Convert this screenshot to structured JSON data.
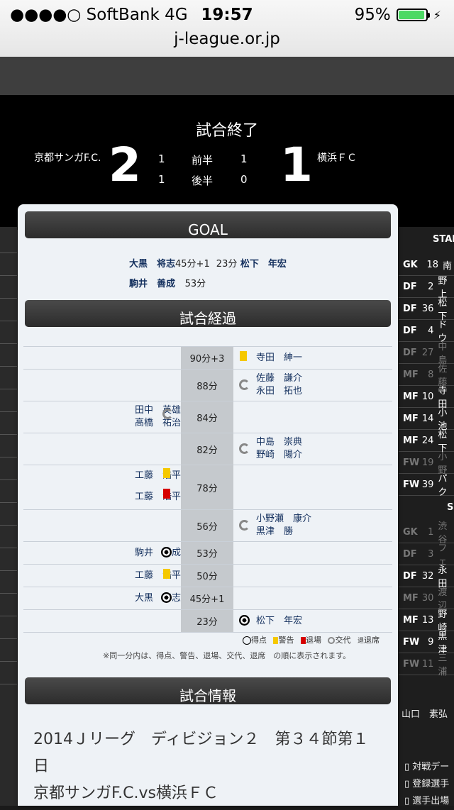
{
  "status_bar": {
    "signal": "●●●●○ SoftBank   4G",
    "time": "19:57",
    "battery": "95%"
  },
  "browser": {
    "url": "j-league.or.jp"
  },
  "score": {
    "status": "試合終了",
    "home_team": "京都サンガF.C.",
    "away_team": "横浜ＦＣ",
    "home_score": "2",
    "away_score": "1",
    "first_half": {
      "label": "前半",
      "home": "1",
      "away": "1"
    },
    "second_half": {
      "label": "後半",
      "home": "1",
      "away": "0"
    }
  },
  "goal_section": {
    "title": "GOAL",
    "goals": [
      {
        "home_player": "大黒　将志",
        "home_time": "45分+1",
        "away_time": "23分",
        "away_player": "松下　年宏"
      },
      {
        "home_player": "駒井　善成",
        "home_time": "53分"
      }
    ]
  },
  "timeline_section": {
    "title": "試合経過",
    "rows": [
      {
        "time": "90分+3",
        "right": [
          "寺田　紳一"
        ],
        "right_icon": "yellow-card-icon"
      },
      {
        "time": "88分",
        "right": [
          "佐藤　謙介",
          "永田　拓也"
        ],
        "right_icon": "substitution-icon"
      },
      {
        "time": "84分",
        "left": [
          "田中　英雄",
          "高橋　祐治"
        ],
        "left_icon": "substitution-icon"
      },
      {
        "time": "82分",
        "right": [
          "中島　崇典",
          "野崎　陽介"
        ],
        "right_icon": "substitution-icon"
      },
      {
        "time": "78分",
        "left": [
          "工藤　浩平",
          "工藤　浩平"
        ],
        "left_icon": "yellow-red-icons"
      },
      {
        "time": "56分",
        "right": [
          "小野瀬　康介",
          "黒津　勝"
        ],
        "right_icon": "substitution-icon"
      },
      {
        "time": "53分",
        "left": [
          "駒井　善成"
        ],
        "left_icon": "ball-icon"
      },
      {
        "time": "50分",
        "left": [
          "工藤　浩平"
        ],
        "left_icon": "yellow-card-icon"
      },
      {
        "time": "45分+1",
        "left": [
          "大黒　将志"
        ],
        "left_icon": "ball-icon"
      },
      {
        "time": "23分",
        "right": [
          "松下　年宏"
        ],
        "right_icon": "ball-icon"
      }
    ],
    "legend": [
      "得点",
      "警告",
      "退場",
      "交代",
      "退席"
    ],
    "legend_prefix": "退",
    "note": "※同一分内は、得点、警告、退場、交代、退席　の順に表示されます。"
  },
  "info_section": {
    "title": "試合情報",
    "competition": "2014Ｊリーグ　ディビジョン２　第３４節第１日",
    "match": "京都サンガF.C.vs横浜ＦＣ"
  },
  "lineup": {
    "header": "STAI",
    "starters": [
      {
        "pos": "GK",
        "num": "18",
        "name": "南",
        "dim": false
      },
      {
        "pos": "DF",
        "num": "2",
        "name": "野上",
        "dim": false
      },
      {
        "pos": "DF",
        "num": "36",
        "name": "松下",
        "dim": false
      },
      {
        "pos": "DF",
        "num": "4",
        "name": "ドウ",
        "dim": false
      },
      {
        "pos": "DF",
        "num": "27",
        "name": "中島",
        "dim": true
      },
      {
        "pos": "MF",
        "num": "8",
        "name": "佐藤",
        "dim": true
      },
      {
        "pos": "MF",
        "num": "10",
        "name": "寺田",
        "dim": false
      },
      {
        "pos": "MF",
        "num": "14",
        "name": "小池",
        "dim": false
      },
      {
        "pos": "MF",
        "num": "24",
        "name": "松下",
        "dim": false
      },
      {
        "pos": "FW",
        "num": "19",
        "name": "小野",
        "dim": true
      },
      {
        "pos": "FW",
        "num": "39",
        "name": "パク",
        "dim": false
      }
    ],
    "subs_header": "S",
    "subs": [
      {
        "pos": "GK",
        "num": "1",
        "name": "渋谷",
        "dim": true
      },
      {
        "pos": "DF",
        "num": "3",
        "name": "フェ",
        "dim": true
      },
      {
        "pos": "DF",
        "num": "32",
        "name": "永田",
        "dim": false
      },
      {
        "pos": "MF",
        "num": "30",
        "name": "渡辺",
        "dim": true
      },
      {
        "pos": "MF",
        "num": "13",
        "name": "野崎",
        "dim": false
      },
      {
        "pos": "FW",
        "num": "9",
        "name": "黒津",
        "dim": false
      },
      {
        "pos": "FW",
        "num": "11",
        "name": "三浦",
        "dim": true
      }
    ],
    "manager": "山口　素弘",
    "links": [
      "対戦デー",
      "登録選手",
      "選手出場"
    ]
  }
}
